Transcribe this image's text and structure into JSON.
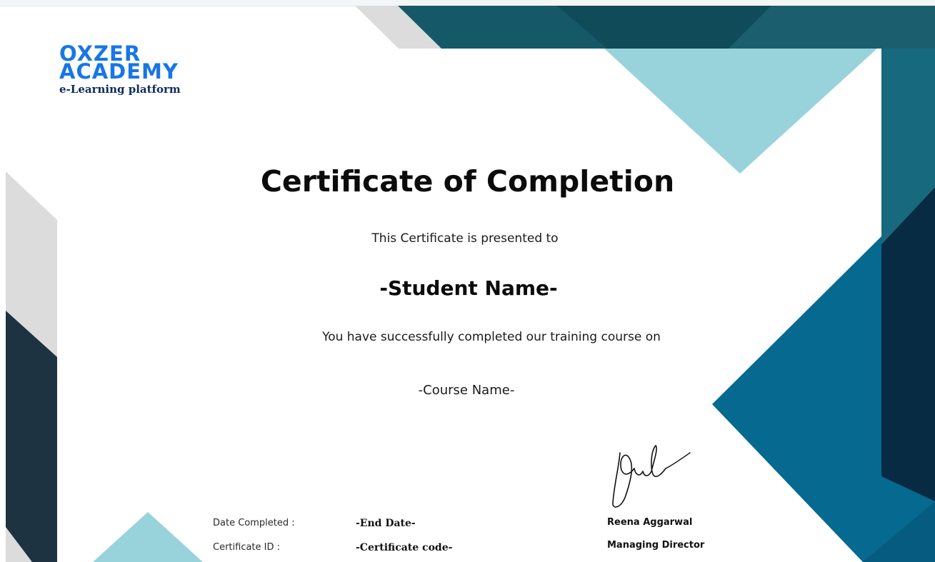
{
  "logo": {
    "line1": "OXZER",
    "line2": "ACADEMY",
    "tagline": "e-Learning platform"
  },
  "certificate": {
    "title": "Certificate of Completion",
    "presented_to": "This Certificate is presented to",
    "student_name": "-Student Name-",
    "completion_text": "You have successfully completed our training course on",
    "course_name": "-Course Name-"
  },
  "details": {
    "date_label": "Date Completed :",
    "date_value": "-End Date-",
    "id_label": "Certificate ID :",
    "id_value": "-Certificate code-"
  },
  "signatory": {
    "name": "Reena Aggarwal",
    "role": "Managing Director"
  },
  "colors": {
    "navy": "#1e3342",
    "teal_dark": "#155968",
    "teal_mid": "#1b6a80",
    "teal_light": "#98d3db",
    "blue": "#06698f",
    "grey_light": "#dcdcdc",
    "logo_blue": "#1876e6"
  }
}
